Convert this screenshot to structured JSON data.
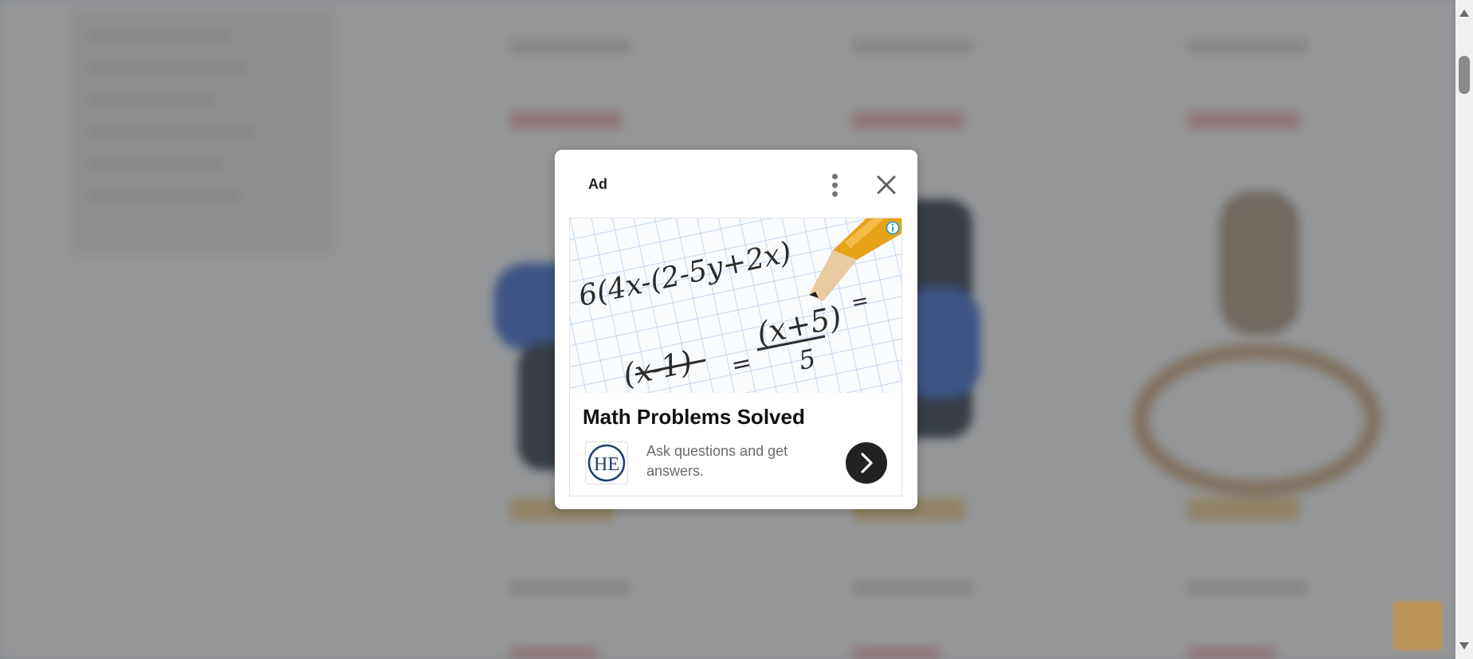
{
  "ad_dialog": {
    "label": "Ad",
    "more_icon": "more-vertical-icon",
    "close_icon": "close-icon",
    "info_icon": "info-icon",
    "headline": "Math Problems Solved",
    "description": "Ask questions and get answers.",
    "logo_text": "HE",
    "cta_icon": "chevron-right-icon",
    "image_text": {
      "line1": "6(4x-(2-5y+2x)",
      "line2": "(x-1)",
      "line3": "(x+5)",
      "line4": "5"
    }
  },
  "colors": {
    "overlay": "#3c4043",
    "cta_background": "#222222",
    "info_icon": "#1aa1d6",
    "pencil": "#e8a21a"
  }
}
